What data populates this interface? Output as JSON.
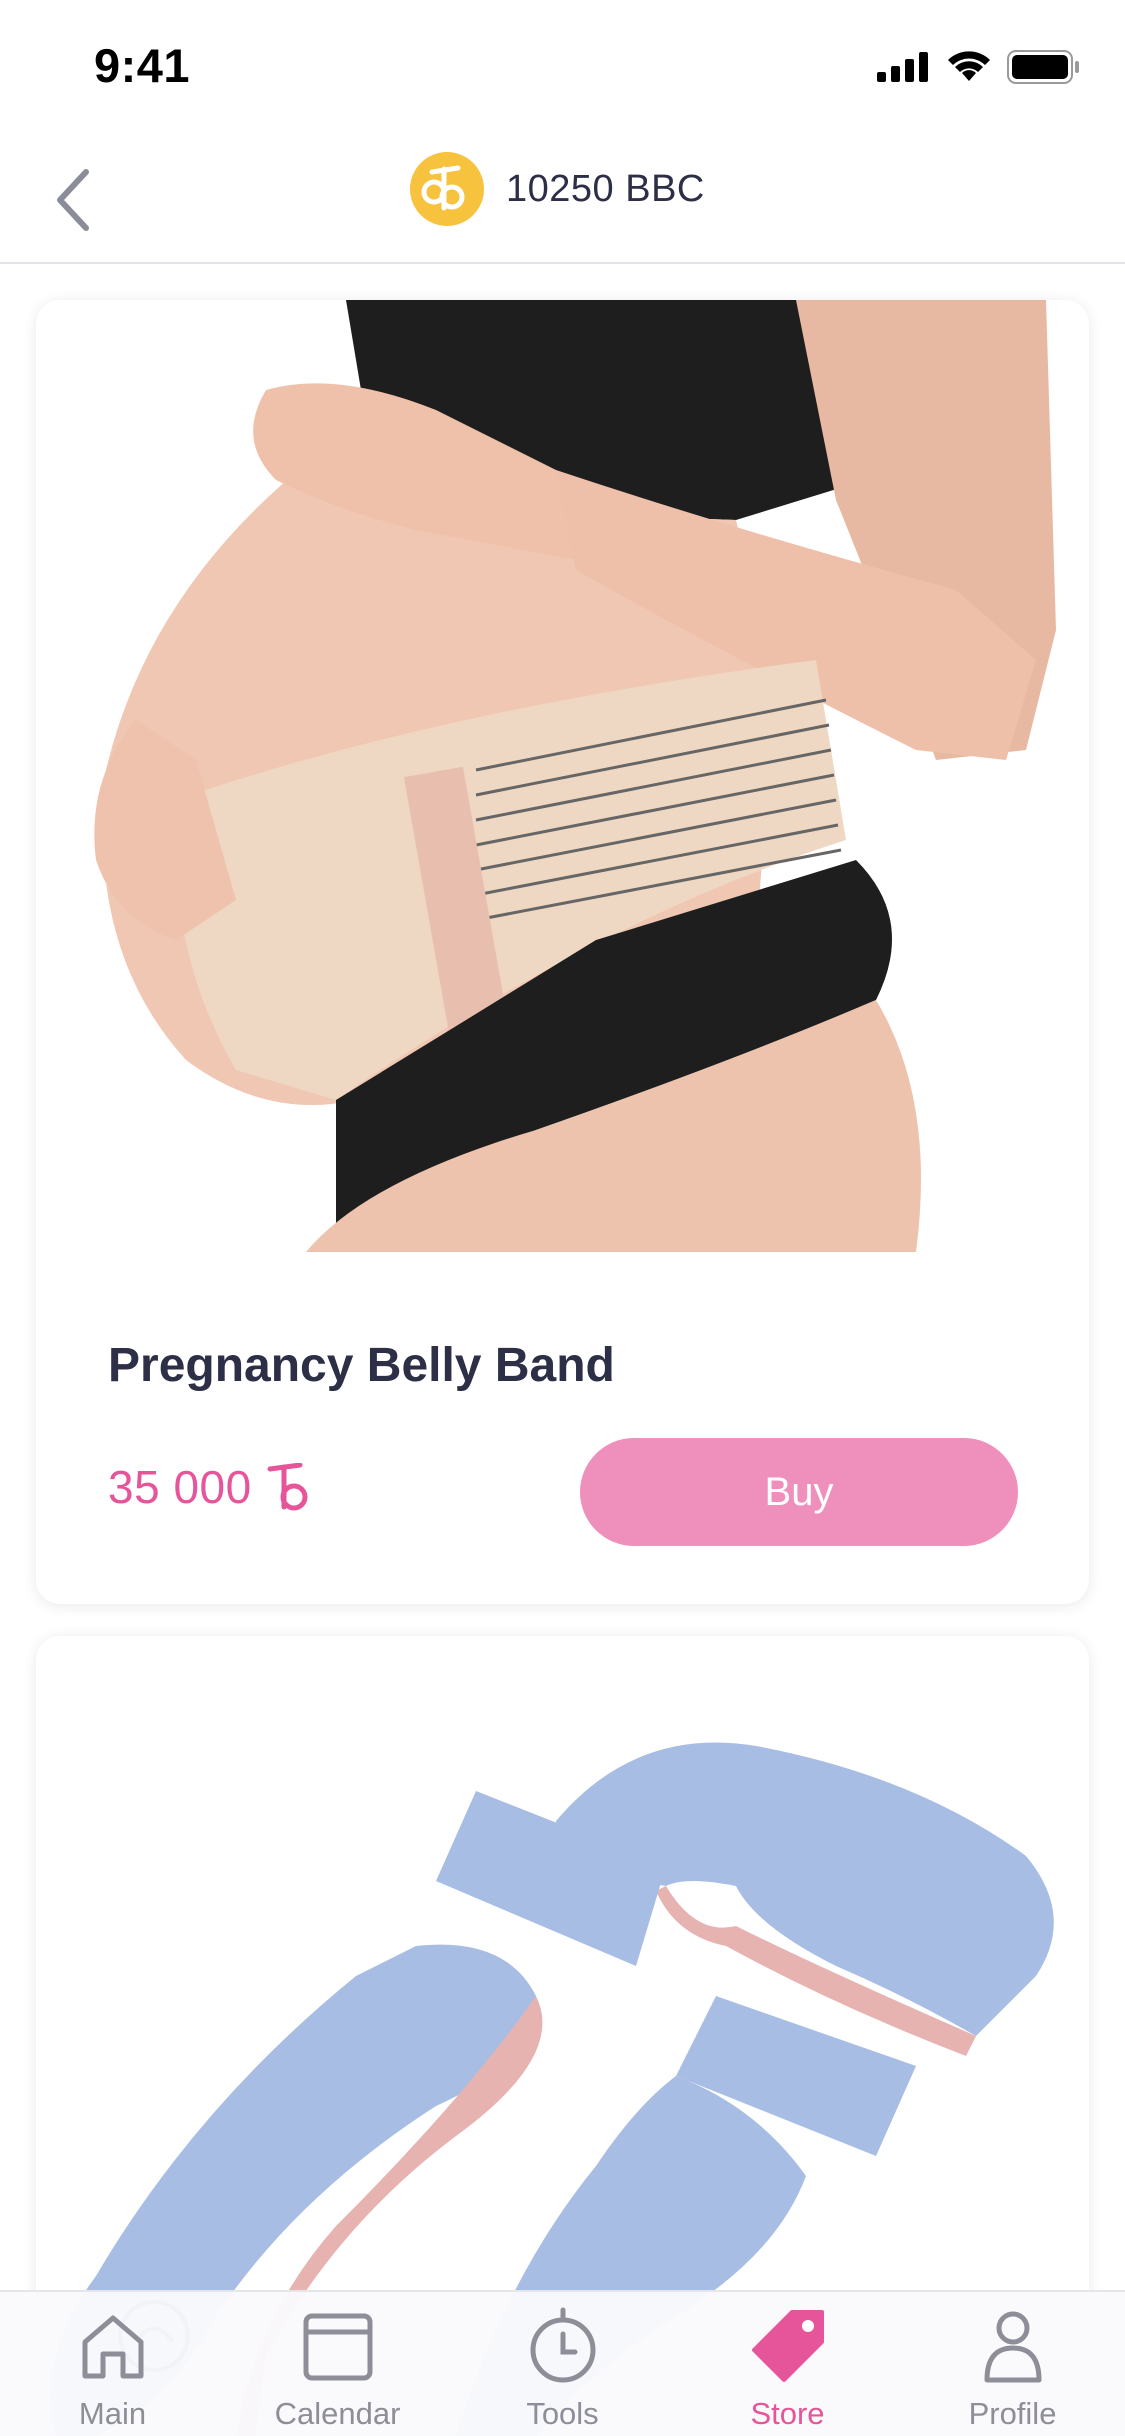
{
  "status_bar": {
    "time": "9:41"
  },
  "header": {
    "balance_text": "10250 BBC",
    "coin_color": "#f7c23e"
  },
  "products": [
    {
      "name": "Pregnancy Belly Band",
      "price": "35 000",
      "buy_label": "Buy",
      "image": "pregnancy-belly-band-photo"
    },
    {
      "name": "",
      "image": "pregnancy-body-pillow-photo"
    }
  ],
  "tab_bar": {
    "tabs": [
      {
        "label": "Main",
        "icon": "home-icon",
        "active": false
      },
      {
        "label": "Calendar",
        "icon": "calendar-icon",
        "active": false
      },
      {
        "label": "Tools",
        "icon": "timer-icon",
        "active": false
      },
      {
        "label": "Store",
        "icon": "tag-icon",
        "active": true
      },
      {
        "label": "Profile",
        "icon": "person-icon",
        "active": false
      }
    ]
  },
  "colors": {
    "accent": "#e6559a",
    "button": "#ef8fbc",
    "text": "#2c2f45",
    "inactive": "#8e8e99"
  }
}
